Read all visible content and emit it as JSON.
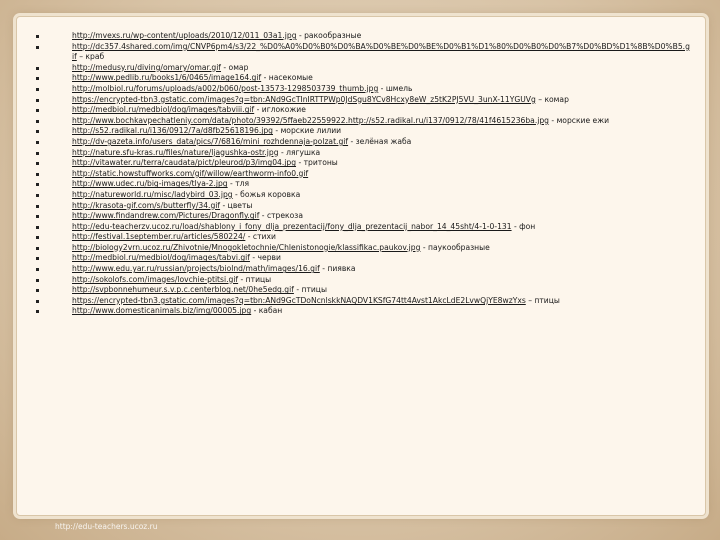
{
  "footer": {
    "watermark": "http://edu-teachers.ucoz.ru"
  },
  "items": [
    {
      "url": "http://mvexs.ru/wp-content/uploads/2010/12/011_03a1.jpg",
      "desc": " - ракообразные"
    },
    {
      "url": "http://dc357.4shared.com/img/CNVP6pm4/s3/22_%D0%A0%D0%B0%D0%BA%D0%BE%D0%BE%D0%B1%D1%80%D0%B0%D0%B7%D0%BD%D1%8B%D0%B5.gif",
      "desc": " – краб"
    },
    {
      "url": "http://medusy.ru/diving/omary/omar.gif",
      "desc": " - омар"
    },
    {
      "url": "http://www.pedlib.ru/books1/6/0465/image164.gif",
      "desc": " - насекомые"
    },
    {
      "url": "http://molbiol.ru/forums/uploads/a002/b060/post-13573-1298503739_thumb.jpg",
      "desc": " - шмель"
    },
    {
      "url": "https://encrypted-tbn3.gstatic.com/images?q=tbn:ANd9GcTInIRTTPWp0JdSgu8YCv8Hcxy8eW_z5tK2PJ5VU_3unX-11YGUVg",
      "desc": " – комар"
    },
    {
      "url": "http://medbiol.ru/medbiol/dog/images/tabviii.gif",
      "desc": " - иглокожие"
    },
    {
      "url": "http://www.bochkavpechatleniy.com/data/photo/39392/5ffaeb22559922.http://s52.radikal.ru/i137/0912/78/41f4615236ba.jpg",
      "desc": " - морские ежи"
    },
    {
      "url": "http://s52.radikal.ru/i136/0912/7a/d8fb25618196.jpg",
      "desc": " - морские лилии"
    },
    {
      "url": "http://dv-gazeta.info/users_data/pics/7/6816/mini_rozhdennaja-polzat.gif",
      "desc": " - зелёная жаба"
    },
    {
      "url": "http://nature.sfu-kras.ru/files/nature/ljagushka-ostr.jpg",
      "desc": " - лягушка"
    },
    {
      "url": "http://vitawater.ru/terra/caudata/pict/pleurod/p3/img04.jpg",
      "desc": " - тритоны"
    },
    {
      "url": "http://static.howstuffworks.com/gif/willow/earthworm-info0.gif",
      "desc": ""
    },
    {
      "url": "http://www.udec.ru/big-images/tlya-2.jpg",
      "desc": " - тля"
    },
    {
      "url": "http://natureworld.ru/misc/ladybird_03.jpg",
      "desc": " - божья коровка"
    },
    {
      "url": "http://krasota-gif.com/s/butterfly/34.gif",
      "desc": " - цветы"
    },
    {
      "url": "http://www.findandrew.com/Pictures/Dragonfly.gif",
      "desc": " - стрекоза"
    },
    {
      "url": "http://edu-teacherzv.ucoz.ru/load/shablony_i_fony_dlja_prezentacij/fony_dlja_prezentacij_nabor_14_45sht/4-1-0-131",
      "desc": " - фон"
    },
    {
      "url": "http://festival.1september.ru/articles/580224/",
      "desc": " - стихи"
    },
    {
      "url": "http://biology2vrn.ucoz.ru/Zhivotnie/Mnogokletochnie/Chlenistonogie/klassifikac.paukov.jpg",
      "desc": " - паукообразные"
    },
    {
      "url": "http://medbiol.ru/medbiol/dog/images/tabvi.gif",
      "desc": " - черви"
    },
    {
      "url": "http://www.edu.yar.ru/russian/projects/biolnd/math/images/16.gif",
      "desc": " - пиявка"
    },
    {
      "url": "http://sokolofs.com/images/lovchie-ptitsi.gif",
      "desc": " - птицы"
    },
    {
      "url": "http://svpbonnehumeur.s.v.p.c.centerblog.net/0he5edq.gif",
      "desc": " - птицы"
    },
    {
      "url": "https://encrypted-tbn3.gstatic.com/images?q=tbn:ANd9GcTDoNcnlskkNAQDV1KSfG74tt4Avst1AkcLdE2LvwQjYE8wzYxs",
      "desc": " – птицы"
    },
    {
      "url": "http://www.domesticanimals.biz/img/00005.jpg",
      "desc": " - кабан"
    }
  ]
}
